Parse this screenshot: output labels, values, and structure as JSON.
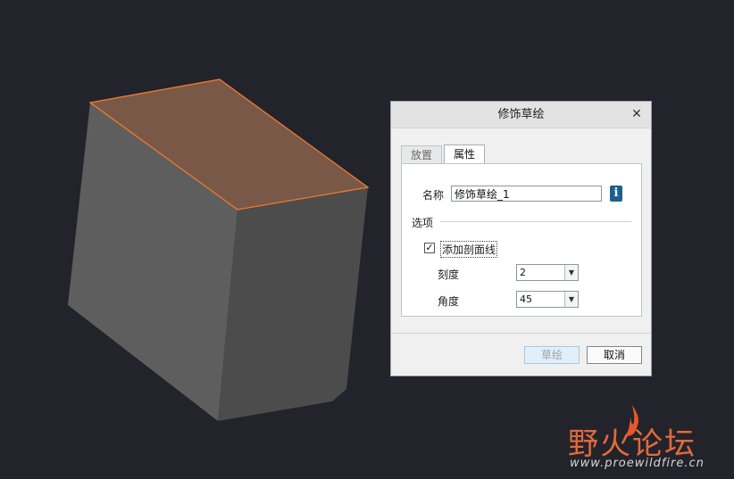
{
  "viewport": {
    "background_color": "#23232b",
    "part_face_top_color": "#7a5847",
    "part_face_left_color": "#5e5e5e",
    "part_face_right_color": "#4c4c4c",
    "highlight_edge_color": "#f07b2c"
  },
  "dialog": {
    "title": "修饰草绘",
    "close_icon": "close-icon",
    "tabs": [
      {
        "label": "放置",
        "active": false
      },
      {
        "label": "属性",
        "active": true
      }
    ],
    "name_label": "名称",
    "name_value": "修饰草绘_1",
    "info_icon": "info-icon",
    "options_label": "选项",
    "hatch_checkbox_label": "添加剖面线",
    "hatch_checked": true,
    "scale_label": "刻度",
    "scale_value": "2",
    "angle_label": "角度",
    "angle_value": "45",
    "sketch_button": "草绘",
    "cancel_button": "取消"
  },
  "watermark": {
    "title": "野火论坛",
    "url": "www.proewildfire.cn",
    "accent_color": "#e06a3b"
  }
}
